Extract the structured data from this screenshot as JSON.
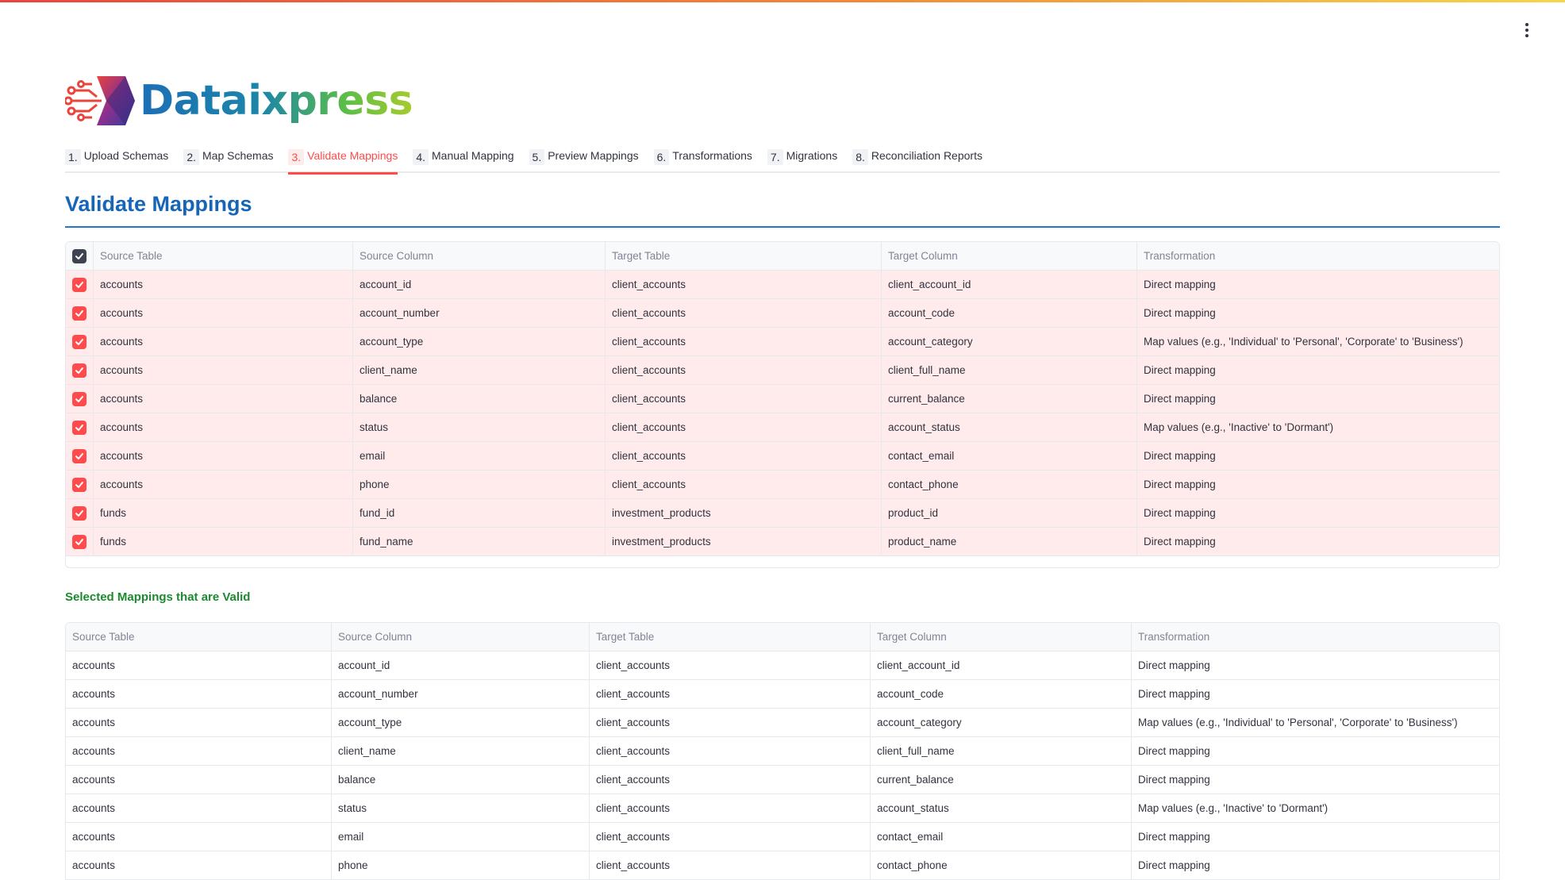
{
  "app": {
    "name": "Dataixpress",
    "accent": "#ff4b4b",
    "title_color": "#1765b6"
  },
  "tabs": [
    {
      "num": "1.",
      "label": "Upload Schemas"
    },
    {
      "num": "2.",
      "label": "Map Schemas"
    },
    {
      "num": "3.",
      "label": "Validate Mappings",
      "active": true
    },
    {
      "num": "4.",
      "label": "Manual Mapping"
    },
    {
      "num": "5.",
      "label": "Preview Mappings"
    },
    {
      "num": "6.",
      "label": "Transformations"
    },
    {
      "num": "7.",
      "label": "Migrations"
    },
    {
      "num": "8.",
      "label": "Reconciliation Reports"
    }
  ],
  "page_title": "Validate Mappings",
  "columns": [
    "Source Table",
    "Source Column",
    "Target Table",
    "Target Column",
    "Transformation"
  ],
  "mapping_rows": [
    [
      "accounts",
      "account_id",
      "client_accounts",
      "client_account_id",
      "Direct mapping"
    ],
    [
      "accounts",
      "account_number",
      "client_accounts",
      "account_code",
      "Direct mapping"
    ],
    [
      "accounts",
      "account_type",
      "client_accounts",
      "account_category",
      "Map values (e.g., 'Individual' to 'Personal', 'Corporate' to 'Business')"
    ],
    [
      "accounts",
      "client_name",
      "client_accounts",
      "client_full_name",
      "Direct mapping"
    ],
    [
      "accounts",
      "balance",
      "client_accounts",
      "current_balance",
      "Direct mapping"
    ],
    [
      "accounts",
      "status",
      "client_accounts",
      "account_status",
      "Map values (e.g., 'Inactive' to 'Dormant')"
    ],
    [
      "accounts",
      "email",
      "client_accounts",
      "contact_email",
      "Direct mapping"
    ],
    [
      "accounts",
      "phone",
      "client_accounts",
      "contact_phone",
      "Direct mapping"
    ],
    [
      "funds",
      "fund_id",
      "investment_products",
      "product_id",
      "Direct mapping"
    ],
    [
      "funds",
      "fund_name",
      "investment_products",
      "product_name",
      "Direct mapping"
    ]
  ],
  "valid_heading": "Selected Mappings that are Valid",
  "valid_rows": [
    [
      "accounts",
      "account_id",
      "client_accounts",
      "client_account_id",
      "Direct mapping"
    ],
    [
      "accounts",
      "account_number",
      "client_accounts",
      "account_code",
      "Direct mapping"
    ],
    [
      "accounts",
      "account_type",
      "client_accounts",
      "account_category",
      "Map values (e.g., 'Individual' to 'Personal', 'Corporate' to 'Business')"
    ],
    [
      "accounts",
      "client_name",
      "client_accounts",
      "client_full_name",
      "Direct mapping"
    ],
    [
      "accounts",
      "balance",
      "client_accounts",
      "current_balance",
      "Direct mapping"
    ],
    [
      "accounts",
      "status",
      "client_accounts",
      "account_status",
      "Map values (e.g., 'Inactive' to 'Dormant')"
    ],
    [
      "accounts",
      "email",
      "client_accounts",
      "contact_email",
      "Direct mapping"
    ],
    [
      "accounts",
      "phone",
      "client_accounts",
      "contact_phone",
      "Direct mapping"
    ]
  ]
}
